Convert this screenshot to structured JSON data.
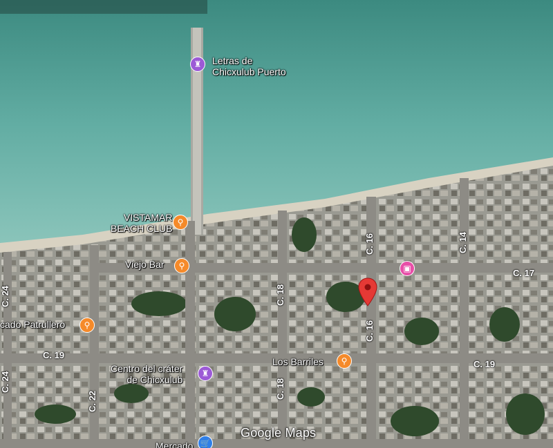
{
  "map": {
    "attribution": "Google Maps",
    "pois": [
      {
        "name_line1": "Letras de",
        "name_line2": "Chicxulub Puerto",
        "icon": "landmark-icon",
        "color": "#9c5ad6"
      },
      {
        "name_line1": "VISTAMAR",
        "name_line2": "BEACH CLUB",
        "icon": "restaurant-icon",
        "color": "#f58a2a"
      },
      {
        "name": "Viejo Bar",
        "icon": "restaurant-icon",
        "color": "#f58a2a"
      },
      {
        "name": "cado Patrullero",
        "icon": "restaurant-icon",
        "color": "#f58a2a"
      },
      {
        "name_line1": "Centro del cráter",
        "name_line2": "de Chicxulub",
        "icon": "landmark-icon",
        "color": "#9c5ad6"
      },
      {
        "name": "Los Barriles",
        "icon": "restaurant-icon",
        "color": "#f58a2a"
      },
      {
        "name": "Mercado",
        "icon": "shopping-icon",
        "color": "#2f7fe8"
      },
      {
        "icon": "hotel-icon",
        "color": "#e84fa8"
      }
    ],
    "streets": {
      "c24": "C. 24",
      "c22": "C. 22",
      "c18": "C. 18",
      "c16": "C. 16",
      "c14": "C. 14",
      "c17": "C. 17",
      "c19": "C. 19"
    },
    "pin_color": "#e53935"
  }
}
